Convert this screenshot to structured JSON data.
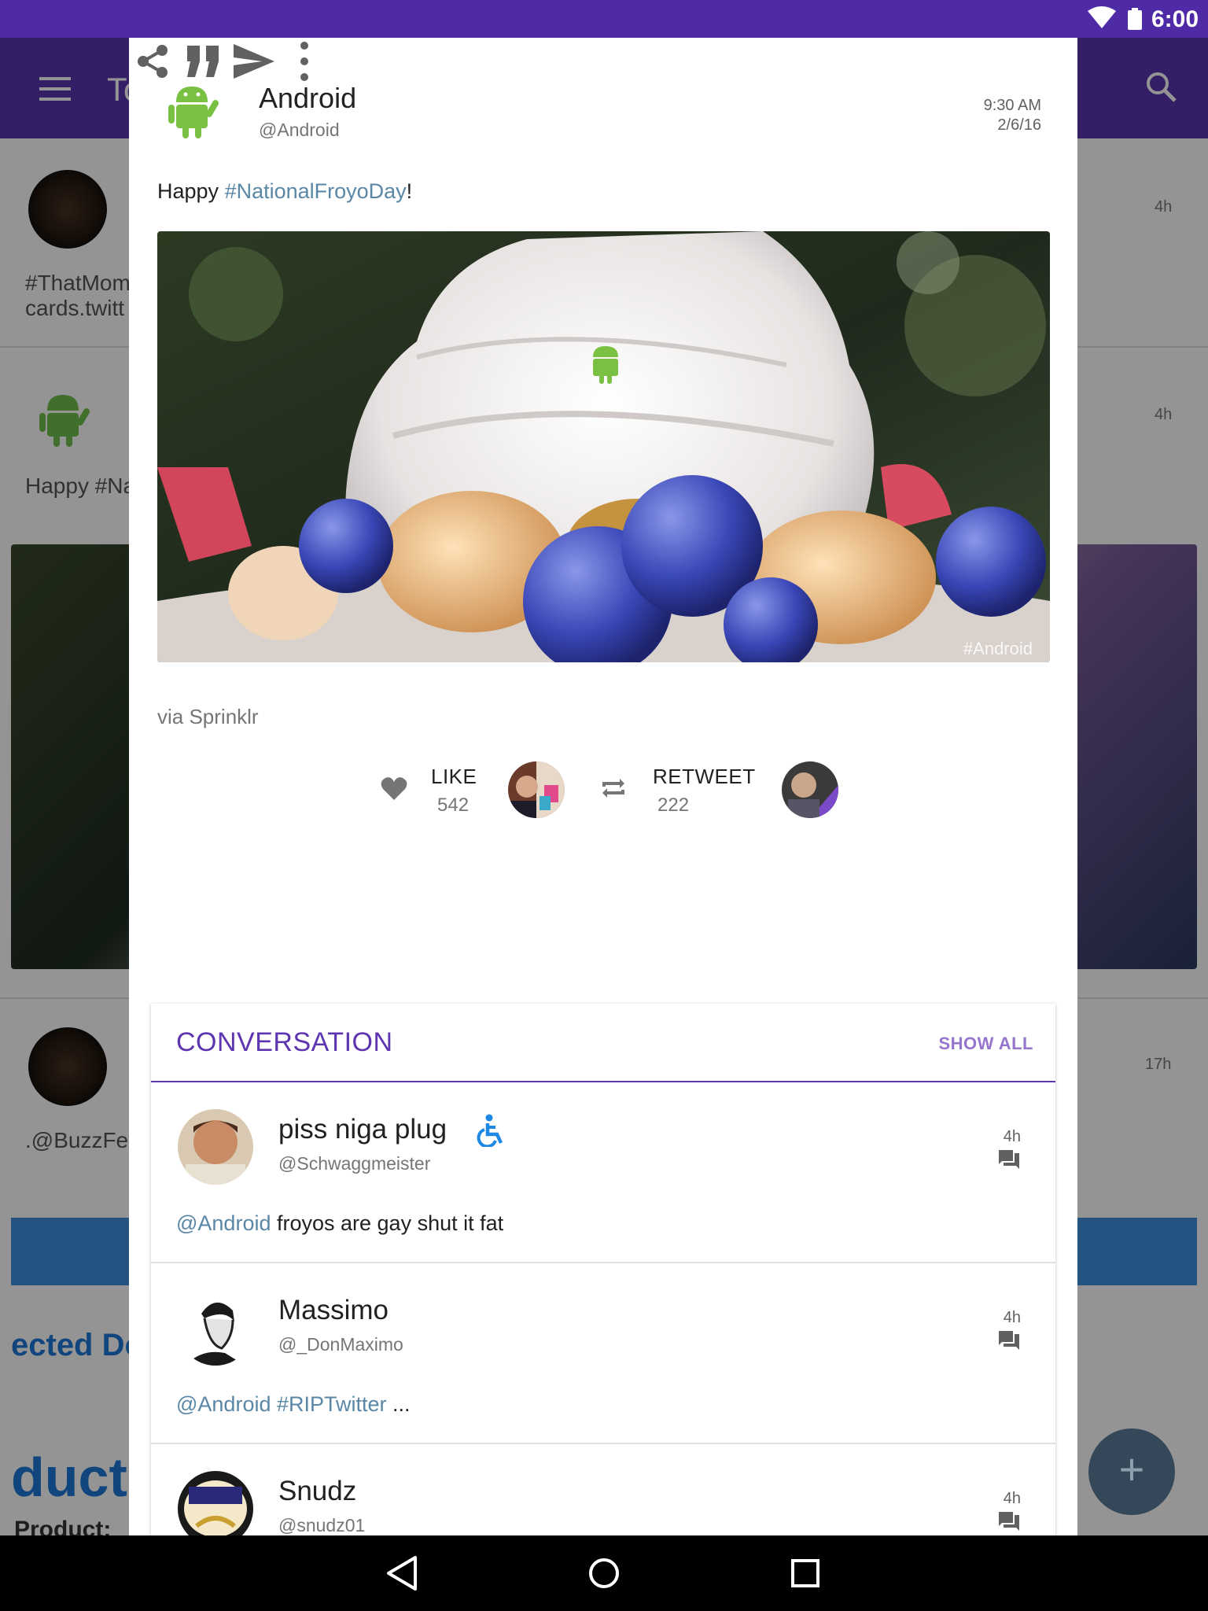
{
  "status_bar": {
    "time": "6:00",
    "icons": [
      "wifi-icon",
      "battery-icon"
    ],
    "color": "#4e2aa7"
  },
  "background_app": {
    "title": "To",
    "timeline_fragments": [
      {
        "time": "4h",
        "text_1": "#ThatMom",
        "text_2": "cards.twitt"
      },
      {
        "time": "4h",
        "text_1": "Happy #Na"
      },
      {
        "time": "17h",
        "text_1": ".@BuzzFee"
      }
    ],
    "promo_fragment_1": "ected Do",
    "promo_fragment_2": "duct",
    "promo_fragment_3": "Product:",
    "toolbar_color": "#5a34b0"
  },
  "tweet": {
    "author_name": "Android",
    "author_handle": "@Android",
    "time": "9:30 AM",
    "date": "2/6/16",
    "text_prefix": "Happy ",
    "hashtag": "#NationalFroyoDay",
    "text_suffix": "!",
    "image_watermark": "#Android",
    "via": "via Sprinklr",
    "like_label": "LIKE",
    "like_count": "542",
    "retweet_label": "RETWEET",
    "retweet_count": "222",
    "actions": [
      "share-icon",
      "quote-icon",
      "send-icon",
      "more-vert-icon"
    ],
    "accent": "#5e35b1",
    "link_color": "#5a87a5"
  },
  "conversation": {
    "title": "CONVERSATION",
    "show_all": "SHOW ALL",
    "replies": [
      {
        "name": "piss niga plug",
        "handle": "@Schwaggmeister",
        "time": "4h",
        "mention": "@Android",
        "text": " froyos are gay shut it fat"
      },
      {
        "name": "Massimo",
        "handle": "@_DonMaximo",
        "time": "4h",
        "mention": "@Android #RIPTwitter",
        "text": " ..."
      },
      {
        "name": "Snudz",
        "handle": "@snudz01",
        "time": "4h",
        "mention": "",
        "text": ""
      }
    ]
  },
  "nav_bar": {
    "buttons": [
      "back-icon",
      "home-icon",
      "recents-icon"
    ]
  }
}
